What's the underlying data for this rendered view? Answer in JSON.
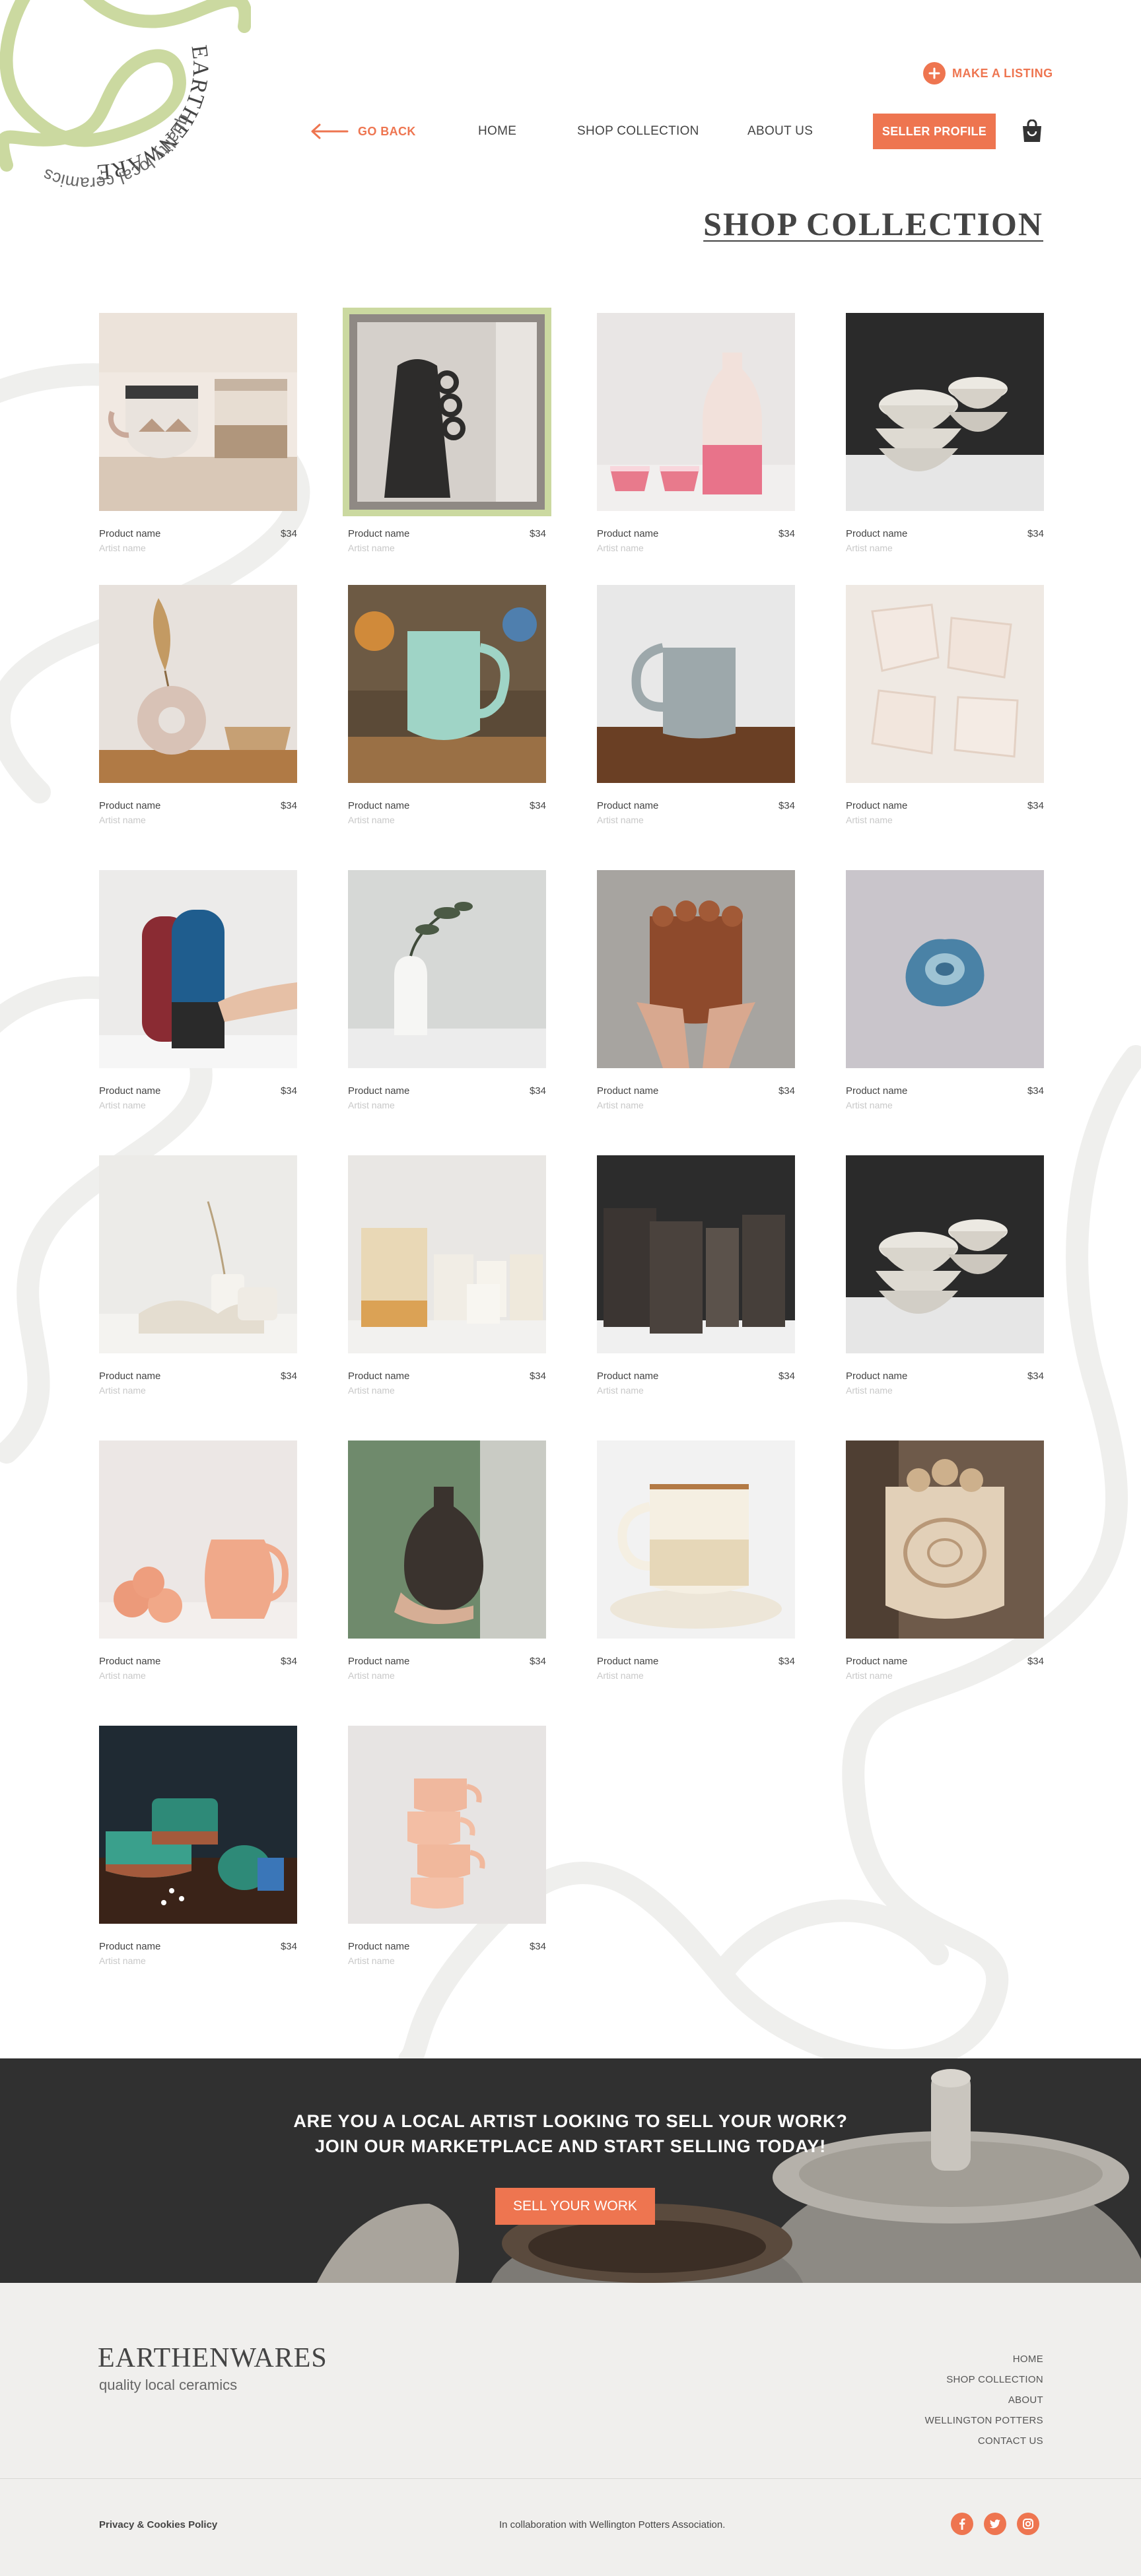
{
  "brand": {
    "name": "EARTHENWARES",
    "tagline": "quality local ceramics",
    "accent_color": "#ee7550",
    "green_color": "#cbd9a0"
  },
  "header": {
    "make_listing": "MAKE A LISTING",
    "go_back": "GO BACK",
    "nav": {
      "home": "HOME",
      "shop": "SHOP COLLECTION",
      "about": "ABOUT US",
      "seller_profile": "SELLER PROFILE"
    }
  },
  "page_title": "SHOP COLLECTION",
  "products": [
    {
      "name": "Product name",
      "price": "$34",
      "artist": "Artist name"
    },
    {
      "name": "Product name",
      "price": "$34",
      "artist": "Artist name"
    },
    {
      "name": "Product name",
      "price": "$34",
      "artist": "Artist name"
    },
    {
      "name": "Product name",
      "price": "$34",
      "artist": "Artist name"
    },
    {
      "name": "Product name",
      "price": "$34",
      "artist": "Artist name"
    },
    {
      "name": "Product name",
      "price": "$34",
      "artist": "Artist name"
    },
    {
      "name": "Product name",
      "price": "$34",
      "artist": "Artist name"
    },
    {
      "name": "Product name",
      "price": "$34",
      "artist": "Artist name"
    },
    {
      "name": "Product name",
      "price": "$34",
      "artist": "Artist name"
    },
    {
      "name": "Product name",
      "price": "$34",
      "artist": "Artist name"
    },
    {
      "name": "Product name",
      "price": "$34",
      "artist": "Artist name"
    },
    {
      "name": "Product name",
      "price": "$34",
      "artist": "Artist name"
    },
    {
      "name": "Product name",
      "price": "$34",
      "artist": "Artist name"
    },
    {
      "name": "Product name",
      "price": "$34",
      "artist": "Artist name"
    },
    {
      "name": "Product name",
      "price": "$34",
      "artist": "Artist name"
    },
    {
      "name": "Product name",
      "price": "$34",
      "artist": "Artist name"
    },
    {
      "name": "Product name",
      "price": "$34",
      "artist": "Artist name"
    },
    {
      "name": "Product name",
      "price": "$34",
      "artist": "Artist name"
    },
    {
      "name": "Product name",
      "price": "$34",
      "artist": "Artist name"
    },
    {
      "name": "Product name",
      "price": "$34",
      "artist": "Artist name"
    },
    {
      "name": "Product name",
      "price": "$34",
      "artist": "Artist name"
    },
    {
      "name": "Product name",
      "price": "$34",
      "artist": "Artist name"
    }
  ],
  "cta": {
    "line1": "ARE YOU A LOCAL ARTIST LOOKING TO SELL YOUR WORK?",
    "line2": "JOIN OUR MARKETPLACE AND START SELLING TODAY!",
    "button": "SELL YOUR WORK"
  },
  "footer": {
    "brand": "EARTHENWARES",
    "tagline": "quality local ceramics",
    "links": [
      "HOME",
      "SHOP COLLECTION",
      "ABOUT",
      "WELLINGTON POTTERS",
      "CONTACT US"
    ],
    "privacy": "Privacy & Cookies Policy",
    "collab": "In collaboration with Wellington Potters Association.",
    "socials": [
      "facebook-icon",
      "twitter-icon",
      "instagram-icon"
    ]
  }
}
